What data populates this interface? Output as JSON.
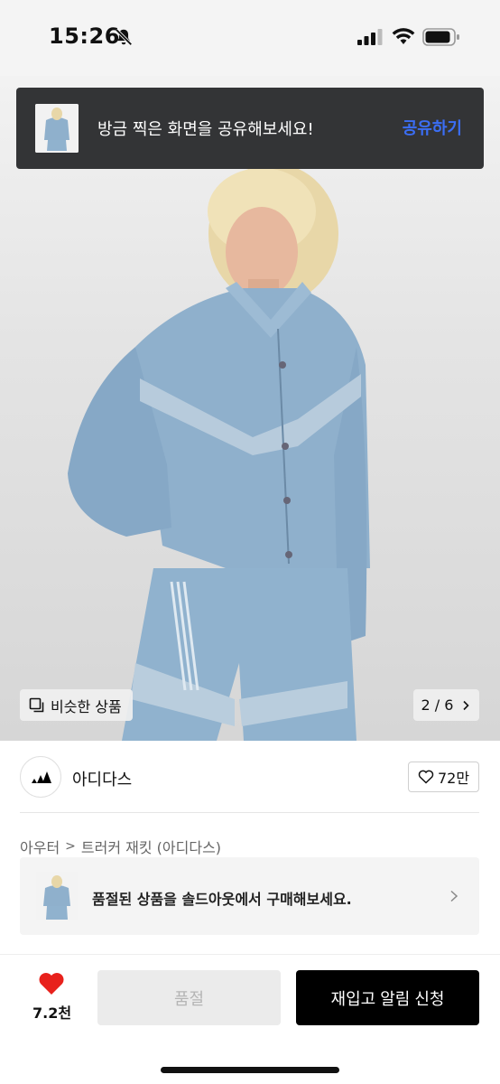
{
  "status_bar": {
    "time": "15:26",
    "icons": [
      "bell-slash-icon",
      "signal-icon",
      "wifi-icon",
      "battery-icon"
    ]
  },
  "share_toast": {
    "message": "방금 찍은 화면을 공유해보세요!",
    "action_label": "공유하기",
    "action_color": "#3b6ef5"
  },
  "image_viewer": {
    "similar_label": "비슷한 상품",
    "page_indicator": "2 / 6"
  },
  "brand": {
    "name": "아디다스",
    "like_count": "72만"
  },
  "breadcrumb": {
    "category": "아우터",
    "product": "트러커 재킷 (아디다스)"
  },
  "promo": {
    "text": "품절된 상품을 솔드아웃에서 구매해보세요."
  },
  "bottom_bar": {
    "wish_count": "7.2천",
    "soldout_label": "품절",
    "restock_label": "재입고 알림 신청",
    "heart_color": "#e8211c"
  }
}
